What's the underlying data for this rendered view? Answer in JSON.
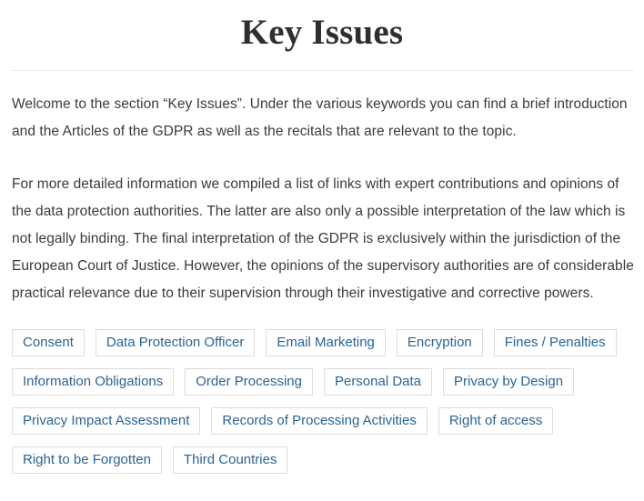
{
  "page": {
    "title": "Key Issues"
  },
  "content": {
    "paragraphs": [
      "Welcome to the section “Key Issues”. Under the various keywords you can find a brief introduction and the Articles of the GDPR as well as the recitals that are relevant to the topic.",
      "For more detailed information we compiled a list of links with expert contributions and opinions of the data protection authorities. The latter are also only a possible interpretation of the law which is not legally binding. The final interpretation of the GDPR is exclusively within the jurisdiction of the European Court of Justice. However, the opinions of the supervisory authorities are of considerable practical relevance due to their supervision through their investigative and corrective powers."
    ]
  },
  "keywords": {
    "rows": [
      [
        "Consent",
        "Data Protection Officer",
        "Email Marketing",
        "Encryption",
        "Fines / Penalties"
      ],
      [
        "Information Obligations",
        "Order Processing",
        "Personal Data",
        "Privacy by Design"
      ],
      [
        "Privacy Impact Assessment",
        "Records of Processing Activities",
        "Right of access"
      ],
      [
        "Right to be Forgotten",
        "Third Countries"
      ]
    ]
  },
  "colors": {
    "title_text": "#2f2f2f",
    "body_text": "#3b3b3b",
    "chip_text": "#2a6496",
    "chip_border": "#dcdcdc",
    "divider": "#ececed",
    "background": "#ffffff"
  }
}
